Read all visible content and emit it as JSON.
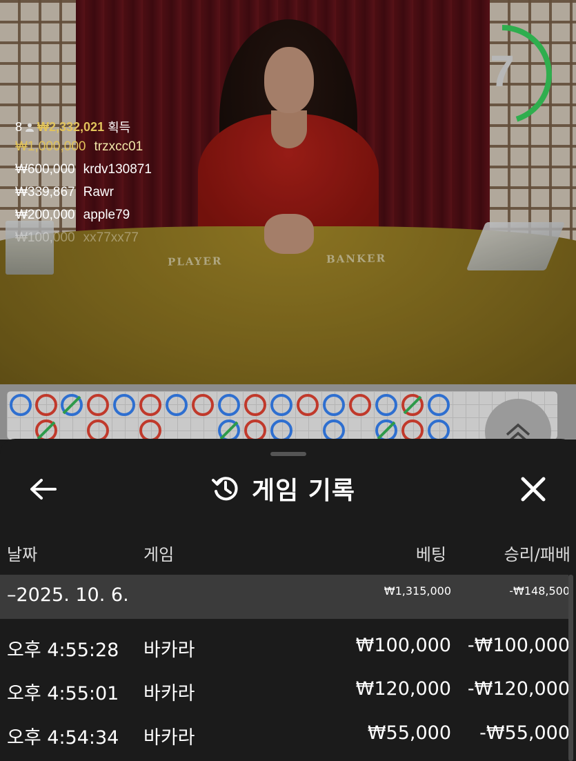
{
  "stream": {
    "felt_player": "PLAYER",
    "felt_banker": "BANKER",
    "timer": "7",
    "timer_progress": 0.45,
    "winners": {
      "count": "8",
      "total": "₩2,332,021",
      "total_label": "획득",
      "list": [
        {
          "amount": "₩1,000,000",
          "name": "trzxcc01"
        },
        {
          "amount": "₩600,000",
          "name": "krdv130871"
        },
        {
          "amount": "₩339,867",
          "name": "Rawr"
        },
        {
          "amount": "₩200,000",
          "name": "apple79"
        },
        {
          "amount": "₩100,000",
          "name": "xx77xx77"
        }
      ]
    }
  },
  "history": {
    "title": "게임 기록",
    "columns": {
      "date": "날짜",
      "game": "게임",
      "bet": "베팅",
      "result": "승리/패배"
    },
    "group": {
      "date": "–2025. 10. 6.",
      "bet": "₩1,315,000",
      "result": "-₩148,500"
    },
    "rows": [
      {
        "time": "오후 4:55:28",
        "game": "바카라",
        "bet": "₩100,000",
        "result": "-₩100,000"
      },
      {
        "time": "오후 4:55:01",
        "game": "바카라",
        "bet": "₩120,000",
        "result": "-₩120,000"
      },
      {
        "time": "오후 4:54:34",
        "game": "바카라",
        "bet": "₩55,000",
        "result": "-₩55,000"
      }
    ]
  },
  "colors": {
    "banker": "#c0392b",
    "player": "#2e6fd0",
    "tie": "#2e9a4a",
    "gold": "#e1c35c",
    "timer": "#2fae4e"
  },
  "icons": [
    "back-arrow-icon",
    "history-icon",
    "close-icon",
    "chevron-up-icon",
    "person-icon"
  ]
}
